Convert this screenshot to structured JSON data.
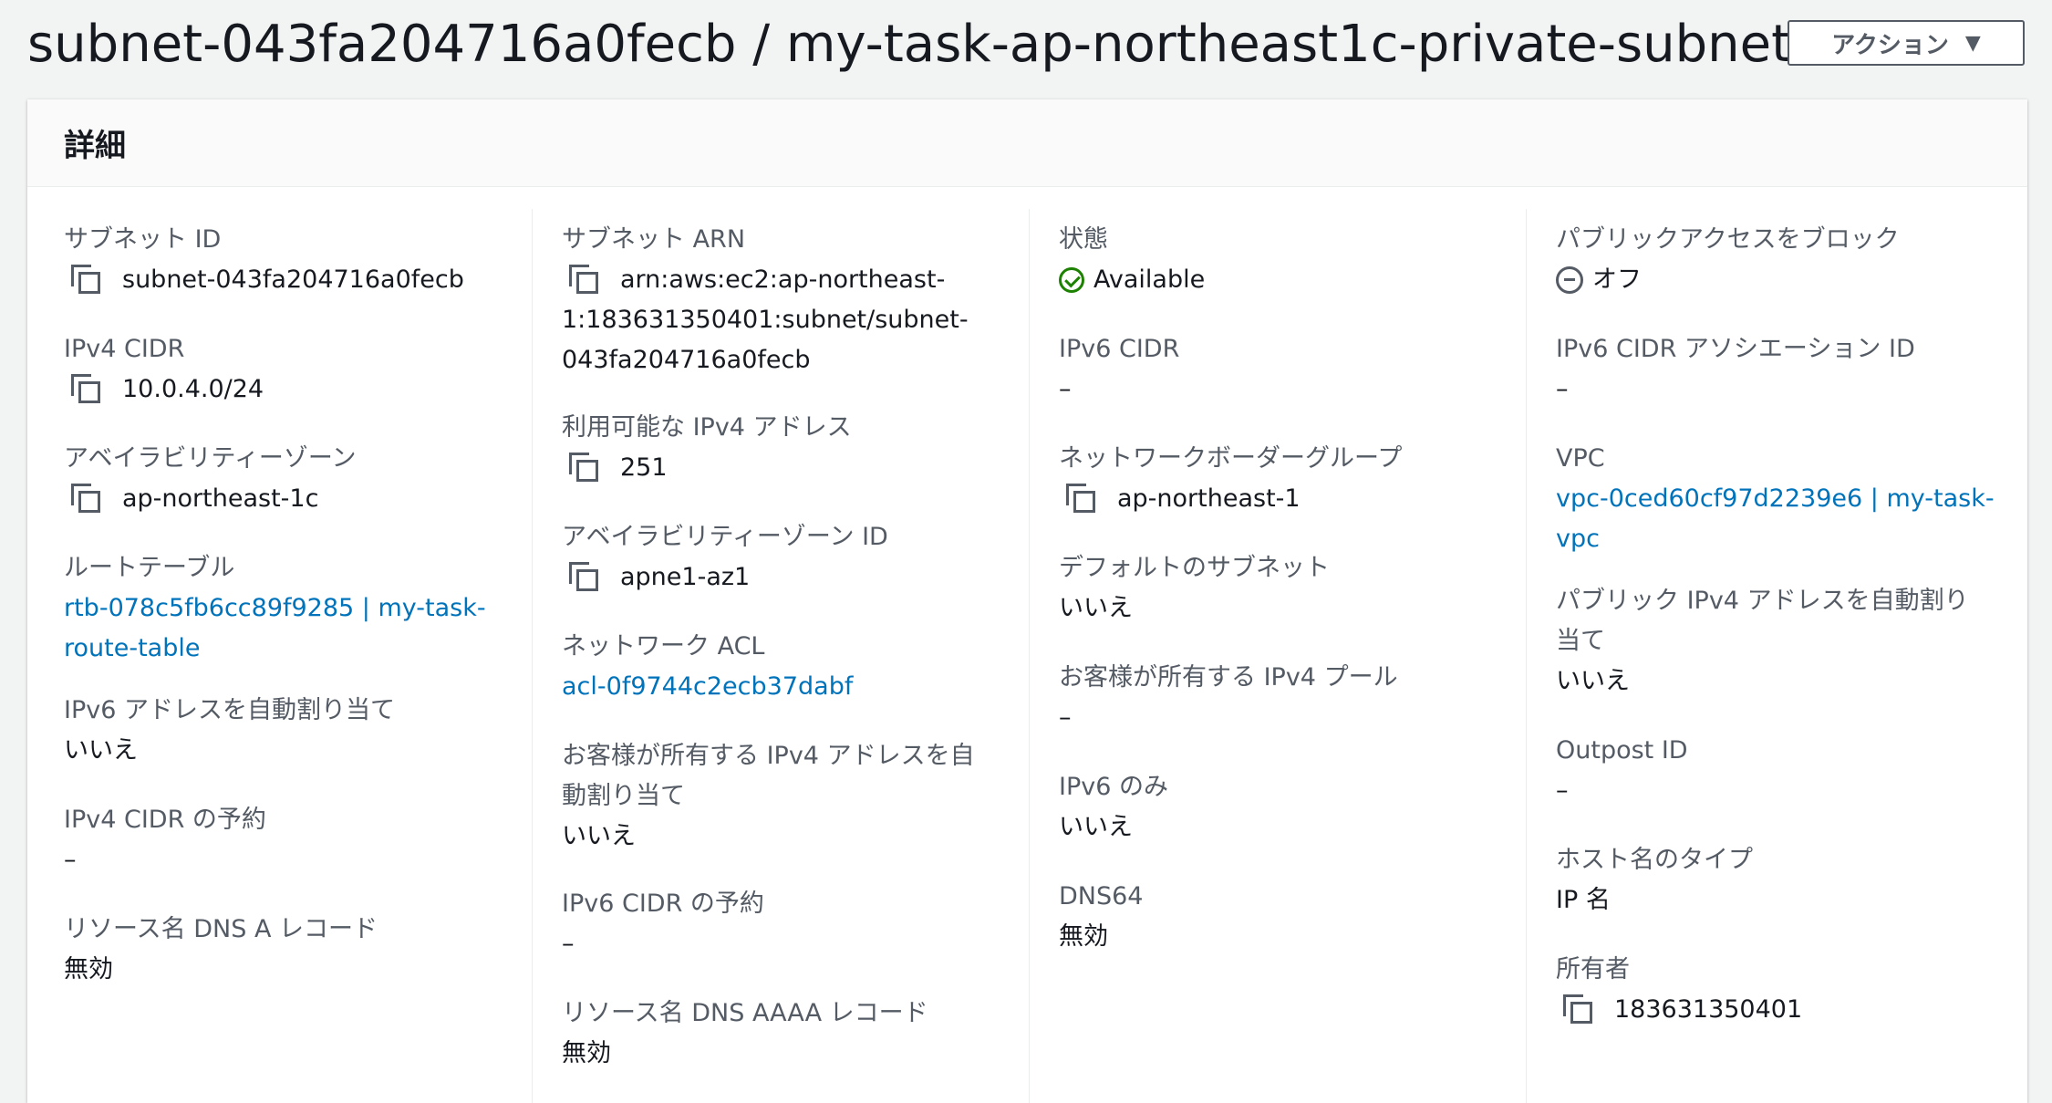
{
  "header": {
    "title": "subnet-043fa204716a0fecb / my-task-ap-northeast1c-private-subnet",
    "actions_label": "アクション"
  },
  "panel": {
    "title": "詳細"
  },
  "col1": {
    "subnet_id_label": "サブネット ID",
    "subnet_id_value": "subnet-043fa204716a0fecb",
    "ipv4_cidr_label": "IPv4 CIDR",
    "ipv4_cidr_value": "10.0.4.0/24",
    "az_label": "アベイラビリティーゾーン",
    "az_value": "ap-northeast-1c",
    "route_table_label": "ルートテーブル",
    "route_table_line1": "rtb-078c5fb6cc89f9285 | my-task-",
    "route_table_line2": "route-table",
    "ipv6_auto_label": "IPv6 アドレスを自動割り当て",
    "ipv6_auto_value": "いいえ",
    "ipv4_reservation_label": "IPv4 CIDR の予約",
    "ipv4_reservation_value": "–",
    "dns_a_label": "リソース名 DNS A レコード",
    "dns_a_value": "無効"
  },
  "col2": {
    "subnet_arn_label": "サブネット ARN",
    "subnet_arn_line1": "arn:aws:ec2:ap-northeast-",
    "subnet_arn_line2": "1:183631350401:subnet/subnet-",
    "subnet_arn_line3": "043fa204716a0fecb",
    "available_ipv4_label": "利用可能な IPv4 アドレス",
    "available_ipv4_value": "251",
    "az_id_label": "アベイラビリティーゾーン ID",
    "az_id_value": "apne1-az1",
    "acl_label": "ネットワーク ACL",
    "acl_value": "acl-0f9744c2ecb37dabf",
    "customer_ipv4_auto_label_line1": "お客様が所有する IPv4 アドレスを自",
    "customer_ipv4_auto_label_line2": "動割り当て",
    "customer_ipv4_auto_value": "いいえ",
    "ipv6_reservation_label": "IPv6 CIDR の予約",
    "ipv6_reservation_value": "–",
    "dns_aaaa_label": "リソース名 DNS AAAA レコード",
    "dns_aaaa_value": "無効"
  },
  "col3": {
    "state_label": "状態",
    "state_value": "Available",
    "ipv6_cidr_label": "IPv6 CIDR",
    "ipv6_cidr_value": "–",
    "border_group_label": "ネットワークボーダーグループ",
    "border_group_value": "ap-northeast-1",
    "default_subnet_label": "デフォルトのサブネット",
    "default_subnet_value": "いいえ",
    "customer_pool_label": "お客様が所有する IPv4 プール",
    "customer_pool_value": "–",
    "ipv6_only_label": "IPv6 のみ",
    "ipv6_only_value": "いいえ",
    "dns64_label": "DNS64",
    "dns64_value": "無効"
  },
  "col4": {
    "block_public_label": "パブリックアクセスをブロック",
    "block_public_value": "オフ",
    "ipv6_assoc_label": "IPv6 CIDR アソシエーション ID",
    "ipv6_assoc_value": "–",
    "vpc_label": "VPC",
    "vpc_line1": "vpc-0ced60cf97d2239e6 | my-task-",
    "vpc_line2": "vpc",
    "public_ipv4_auto_label_line1": "パブリック IPv4 アドレスを自動割り",
    "public_ipv4_auto_label_line2": "当て",
    "public_ipv4_auto_value": "いいえ",
    "outpost_label": "Outpost ID",
    "outpost_value": "–",
    "hostname_type_label": "ホスト名のタイプ",
    "hostname_type_value": "IP 名",
    "owner_label": "所有者",
    "owner_value": "183631350401"
  }
}
